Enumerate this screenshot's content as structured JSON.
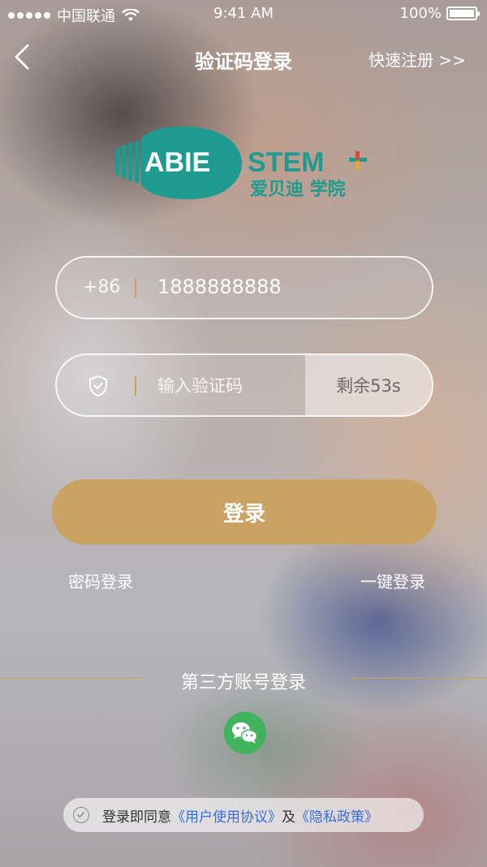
{
  "status_bar": {
    "carrier": "中国联通",
    "time": "9:41 AM",
    "battery": "100%"
  },
  "nav": {
    "title": "验证码登录",
    "right_link": "快速注册 >>"
  },
  "logo": {
    "brand": "ABIE STEM",
    "subtitle": "爱贝迪 学院"
  },
  "phone_field": {
    "prefix": "+86",
    "value": "1888888888"
  },
  "code_field": {
    "placeholder": "输入验证码",
    "countdown": "剩余53s"
  },
  "login_button": "登录",
  "links": {
    "password_login": "密码登录",
    "one_click_login": "一键登录"
  },
  "third_party": {
    "title": "第三方账号登录"
  },
  "agreement": {
    "prefix": "登录即同意",
    "terms": "《用户使用协议》",
    "and": "及",
    "privacy": "《隐私政策》"
  },
  "colors": {
    "accent": "#c9a264",
    "teal": "#1e9a90",
    "wechat": "#41b35d",
    "link": "#3a6fd8"
  }
}
